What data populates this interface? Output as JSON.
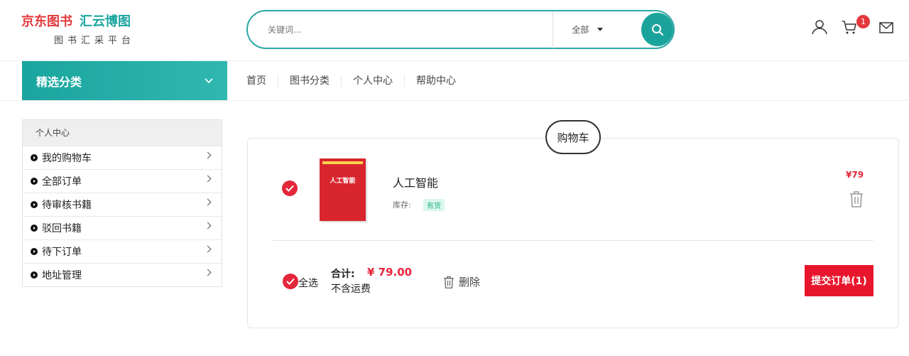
{
  "brand": {
    "logo_left": "京东图书",
    "logo_right": "汇云博图",
    "subtitle": "图书汇采平台"
  },
  "search": {
    "placeholder": "关键词...",
    "scope": "全部"
  },
  "header_icons": {
    "user": "user-icon",
    "cart": "cart-icon",
    "cart_count": "1",
    "mail": "mail-icon"
  },
  "category": {
    "label": "精选分类"
  },
  "nav": {
    "items": [
      "首页",
      "图书分类",
      "个人中心",
      "帮助中心"
    ]
  },
  "sidebar": {
    "header": "个人中心",
    "items": [
      "我的购物车",
      "全部订单",
      "待审核书籍",
      "驳回书籍",
      "待下订单",
      "地址管理"
    ]
  },
  "cart": {
    "title": "购物车",
    "product": {
      "name": "人工智能",
      "cover_title": "人工智能",
      "stock_label": "库存:",
      "stock_status": "有货",
      "price": "¥79"
    },
    "footer": {
      "select_all": "全选",
      "total_label": "合计:",
      "total_value": "¥ 79.00",
      "shipping_note": "不含运费",
      "delete_label": "删除",
      "submit_label": "提交订单(1)"
    }
  },
  "colors": {
    "teal": "#1aa39b",
    "red": "#e4273a"
  }
}
